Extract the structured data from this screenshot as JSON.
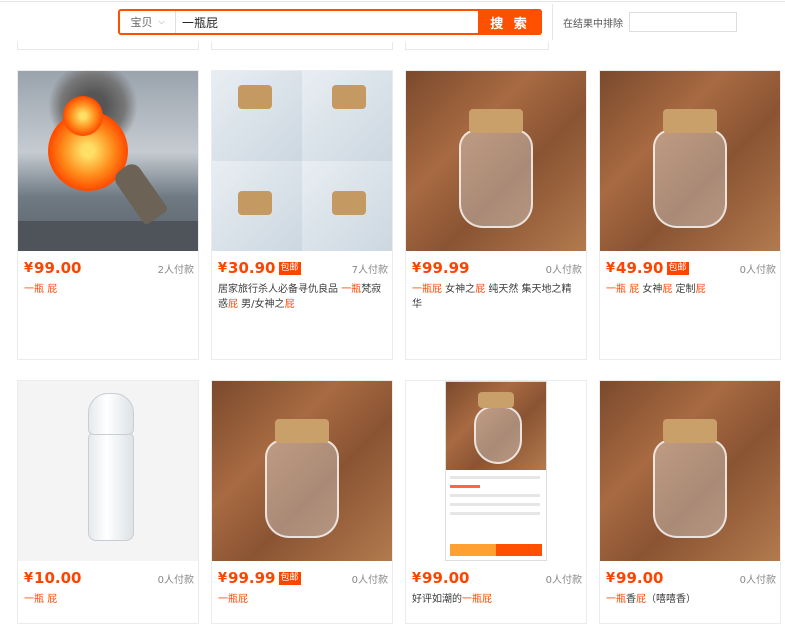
{
  "search": {
    "type_label": "宝贝",
    "query": "一瓶屁",
    "button_label": "搜 索",
    "exclude_label": "在结果中排除"
  },
  "products": [
    {
      "price": "99.00",
      "baoyou": "",
      "buyers": "2人付款",
      "title_parts": [
        "一瓶",
        " ",
        "屁"
      ],
      "title_hl": [
        true,
        false,
        true
      ],
      "image": "explosion"
    },
    {
      "price": "30.90",
      "baoyou": "包邮",
      "buyers": "7人付款",
      "title_parts": [
        "居家旅行杀人必备寻仇良品 ",
        "一瓶",
        "梵寂惑",
        "屁",
        " 男/女神之",
        "屁"
      ],
      "title_hl": [
        false,
        true,
        false,
        true,
        false,
        true
      ],
      "image": "collage"
    },
    {
      "price": "99.99",
      "baoyou": "",
      "buyers": "0人付款",
      "title_parts": [
        "一瓶",
        "屁",
        " 女神之",
        "屁",
        " 纯天然 集天地之精华"
      ],
      "title_hl": [
        true,
        true,
        false,
        true,
        false
      ],
      "image": "jar"
    },
    {
      "price": "49.90",
      "baoyou": "包邮",
      "buyers": "0人付款",
      "title_parts": [
        "一瓶",
        " ",
        "屁",
        " 女神",
        "屁",
        " 定制",
        "屁"
      ],
      "title_hl": [
        true,
        false,
        true,
        false,
        true,
        false,
        true
      ],
      "image": "jar"
    },
    {
      "price": "10.00",
      "baoyou": "",
      "buyers": "0人付款",
      "title_parts": [
        "一瓶",
        " ",
        "屁"
      ],
      "title_hl": [
        true,
        false,
        true
      ],
      "image": "bottle"
    },
    {
      "price": "99.99",
      "baoyou": "包邮",
      "buyers": "0人付款",
      "title_parts": [
        "一瓶屁"
      ],
      "title_hl": [
        true
      ],
      "image": "jar"
    },
    {
      "price": "99.00",
      "baoyou": "",
      "buyers": "0人付款",
      "title_parts": [
        "好评如潮的",
        "一瓶屁"
      ],
      "title_hl": [
        false,
        true
      ],
      "image": "phone"
    },
    {
      "price": "99.00",
      "baoyou": "",
      "buyers": "0人付款",
      "title_parts": [
        "一瓶",
        "香",
        "屁",
        "（嘻嘻香）"
      ],
      "title_hl": [
        true,
        false,
        true,
        false
      ],
      "image": "jar"
    }
  ],
  "currency_symbol": "¥",
  "colors": {
    "accent": "#ff5000",
    "price": "#ff4400"
  }
}
